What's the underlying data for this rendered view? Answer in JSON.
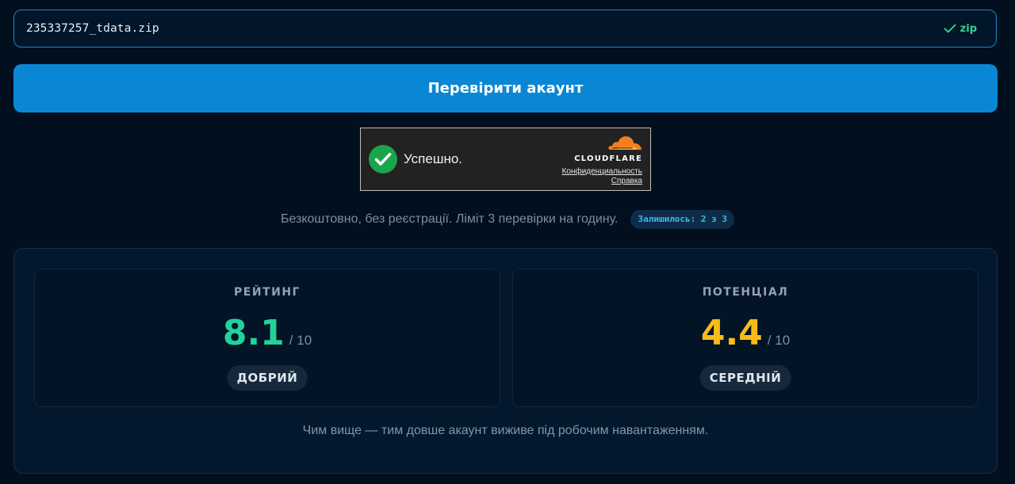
{
  "file": {
    "name": "235337257_tdata.zip",
    "extension": "zip",
    "status_icon": "check-icon",
    "status_color": "#2ed397"
  },
  "actions": {
    "check_label": "Перевірити акаунт",
    "button_color": "#0a87d4"
  },
  "turnstile": {
    "status_text": "Успешно.",
    "brand": "CLOUDFLARE",
    "privacy_link": "Конфиденциальность",
    "help_link": "Справка",
    "brand_color": "#f38020"
  },
  "info": {
    "text": "Безкоштовно, без реєстрації. Ліміт 3 перевірки на годину.",
    "remaining": "Залишилось: 2 з 3"
  },
  "results": {
    "rating": {
      "title": "РЕЙТИНГ",
      "score": "8.1",
      "max": "/ 10",
      "label": "ДОБРИЙ",
      "color": "#20d39a"
    },
    "potential": {
      "title": "ПОТЕНЦІАЛ",
      "score": "4.4",
      "max": "/ 10",
      "label": "СЕРЕДНІЙ",
      "color": "#f7bd16"
    },
    "note": "Чим вище — тим довше акаунт виживе під робочим навантаженням."
  }
}
